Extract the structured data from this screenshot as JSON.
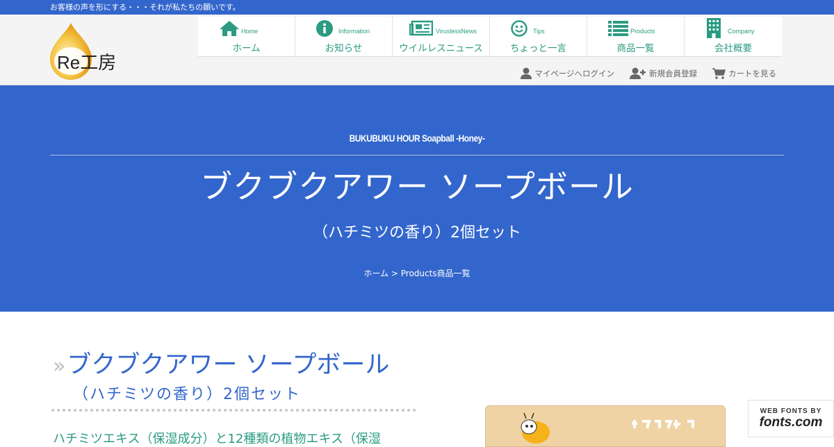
{
  "topbar": {
    "tagline": "お客様の声を形にする・・・それが私たちの願いです。"
  },
  "logo": {
    "text": "Re工房"
  },
  "nav": [
    {
      "en": "Home",
      "jp": "ホーム",
      "icon": "home-icon"
    },
    {
      "en": "Information",
      "jp": "お知らせ",
      "icon": "info-icon"
    },
    {
      "en": "ViruslessNews",
      "jp": "ウイルレスニュース",
      "icon": "newspaper-icon"
    },
    {
      "en": "Tips",
      "jp": "ちょっと一言",
      "icon": "smile-icon"
    },
    {
      "en": "Products",
      "jp": "商品一覧",
      "icon": "list-icon"
    },
    {
      "en": "Company",
      "jp": "会社概要",
      "icon": "building-icon"
    }
  ],
  "user_links": {
    "mypage": "マイページへログイン",
    "register": "新規会員登録",
    "cart": "カートを見る"
  },
  "hero": {
    "subtitle": "BUKUBUKU HOUR Soapball -Honey-",
    "title": "ブクブクアワー ソープボール",
    "title2": "（ハチミツの香り）2個セット",
    "breadcrumb": "ホーム > Products商品一覧"
  },
  "main": {
    "title": "ブクブクアワー ソープボール",
    "title2": "（ハチミツの香り）2個セット",
    "raquo": "»",
    "desc": "ハチミツエキス（保湿成分）と12種類の植物エキス（保湿"
  },
  "badge": {
    "top": "WEB FONTS BY",
    "bottom": "fonts.com"
  },
  "colors": {
    "brand": "#3366cc",
    "accent": "#2b9b82"
  }
}
